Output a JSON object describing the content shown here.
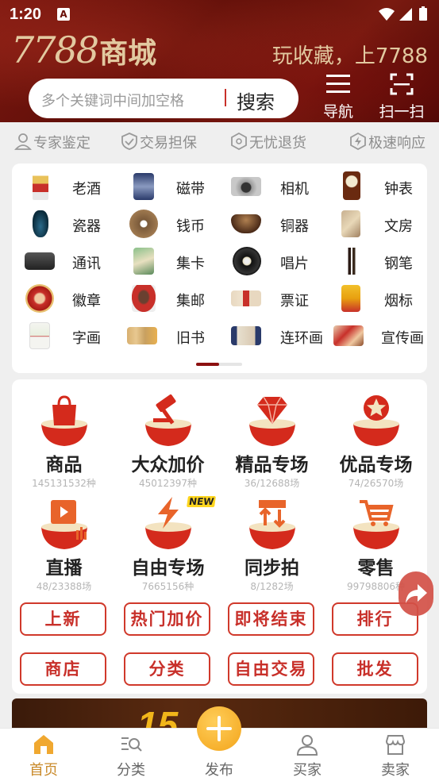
{
  "status_bar": {
    "time": "1:20",
    "notif_badge": "A"
  },
  "header": {
    "logo_number": "7788",
    "logo_text": "商城",
    "slogan": "玩收藏，上7788",
    "search_placeholder": "多个关键词中间加空格",
    "search_button": "搜索",
    "nav_label": "导航",
    "scan_label": "扫一扫"
  },
  "guarantees": [
    "专家鉴定",
    "交易担保",
    "无忧退货",
    "极速响应"
  ],
  "categories": [
    "老酒",
    "磁带",
    "相机",
    "钟表",
    "瓷器",
    "钱币",
    "铜器",
    "文房",
    "通讯",
    "集卡",
    "唱片",
    "钢笔",
    "徽章",
    "集邮",
    "票证",
    "烟标",
    "字画",
    "旧书",
    "连环画",
    "宣传画"
  ],
  "features": [
    {
      "title": "商品",
      "sub": "145131532种"
    },
    {
      "title": "大众加价",
      "sub": "45012397种"
    },
    {
      "title": "精品专场",
      "sub": "36/12688场"
    },
    {
      "title": "优品专场",
      "sub": "74/26570场"
    },
    {
      "title": "直播",
      "sub": "48/23388场"
    },
    {
      "title": "自由专场",
      "sub": "7665156种"
    },
    {
      "title": "同步拍",
      "sub": "8/1282场"
    },
    {
      "title": "零售",
      "sub": "99798806种"
    }
  ],
  "new_badge": "NEW",
  "action_buttons": [
    "上新",
    "热门加价",
    "即将结束",
    "排行",
    "商店",
    "分类",
    "自由交易",
    "批发"
  ],
  "banner_text": "15",
  "bottom_nav": [
    {
      "label": "首页",
      "icon": "home-icon"
    },
    {
      "label": "分类",
      "icon": "category-search-icon"
    },
    {
      "label": "发布",
      "icon": "plus-icon"
    },
    {
      "label": "买家",
      "icon": "user-icon"
    },
    {
      "label": "卖家",
      "icon": "store-icon"
    }
  ],
  "colors": {
    "accent_red": "#c8302a",
    "header_dark_red": "#6a1008",
    "gold_text": "#e2c9a0",
    "nav_active": "#c98a2a",
    "publish_orange": "#f3a41a"
  }
}
